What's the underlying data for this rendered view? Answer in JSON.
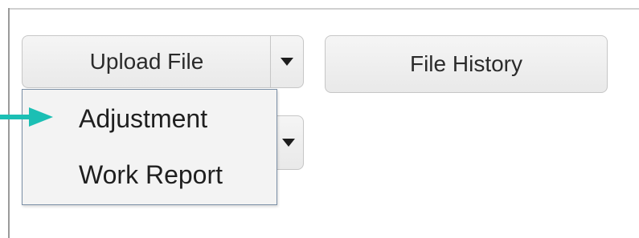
{
  "toolbar": {
    "upload_label": "Upload File",
    "history_label": "File History"
  },
  "menu": {
    "items": [
      {
        "label": "Adjustment",
        "highlighted": true
      },
      {
        "label": "Work Report"
      }
    ]
  },
  "icons": {
    "caret": "chevron-down-icon",
    "pointer": "arrow-right-icon"
  },
  "colors": {
    "pointer_arrow": "#1bbfb4",
    "menu_border": "#7b8fa6",
    "button_bg": "#efefef"
  }
}
